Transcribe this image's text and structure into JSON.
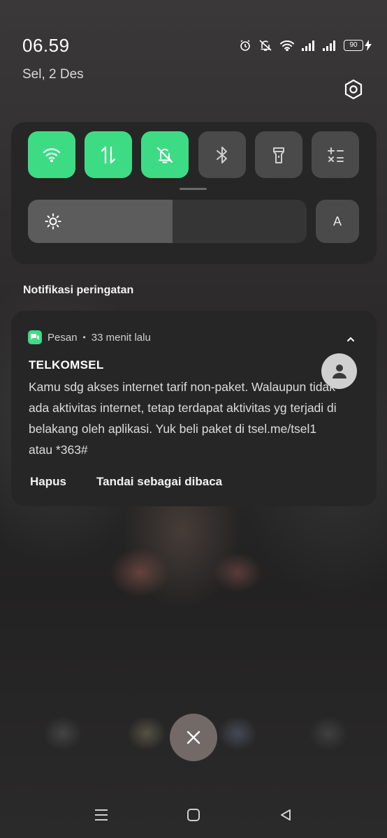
{
  "status_bar": {
    "time": "06.59",
    "battery_level": "90",
    "icons": [
      "alarm-icon",
      "mute-icon",
      "wifi-icon",
      "signal-icon",
      "signal-icon",
      "battery-icon",
      "charging-icon"
    ]
  },
  "date": "Sel, 2 Des",
  "quick_settings": {
    "tiles": [
      {
        "name": "wifi",
        "icon": "wifi-icon",
        "active": true
      },
      {
        "name": "mobile-data",
        "icon": "data-arrows-icon",
        "active": true
      },
      {
        "name": "silent",
        "icon": "bell-off-icon",
        "active": true
      },
      {
        "name": "bluetooth",
        "icon": "bluetooth-icon",
        "active": false
      },
      {
        "name": "flashlight",
        "icon": "flashlight-icon",
        "active": false
      },
      {
        "name": "calculator",
        "icon": "calculator-icon",
        "active": false
      }
    ],
    "brightness_level": 0.52,
    "auto_brightness_label": "A"
  },
  "section_title": "Notifikasi peringatan",
  "notification": {
    "app_name": "Pesan",
    "separator": "•",
    "time_ago": "33 menit lalu",
    "title": "TELKOMSEL",
    "body": "Kamu sdg akses internet tarif non-paket. Walaupun tidak ada aktivitas internet, tetap terdapat aktivitas yg terjadi di belakang oleh aplikasi. Yuk beli paket di tsel.me/tsel1 atau *363#",
    "actions": [
      "Hapus",
      "Tandai sebagai dibaca"
    ]
  },
  "colors": {
    "accent": "#3ddc84",
    "tile_off": "#4a4a4a",
    "panel": "#262626"
  }
}
